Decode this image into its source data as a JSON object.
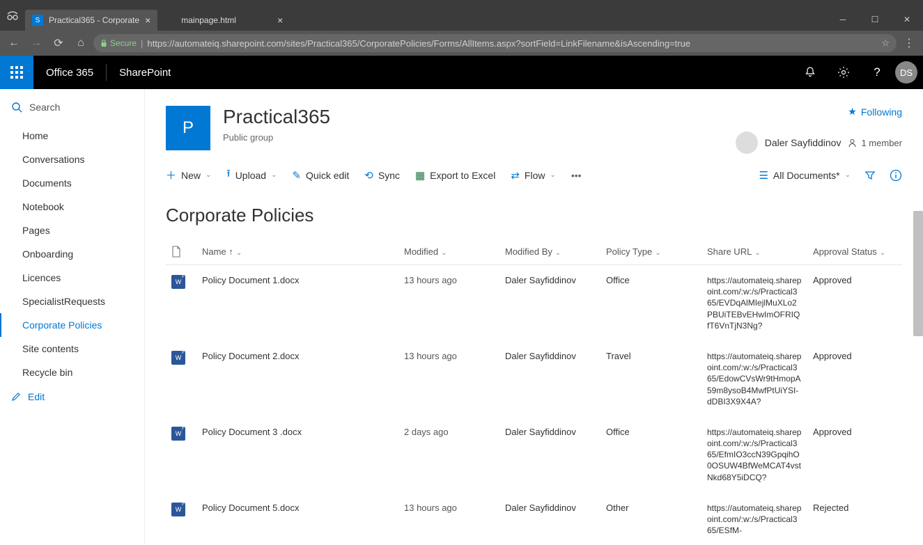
{
  "browser": {
    "tabs": [
      {
        "title": "Practical365 - Corporate",
        "favicon": "S",
        "active": true
      },
      {
        "title": "mainpage.html",
        "favicon": "",
        "active": false
      }
    ],
    "secure_label": "Secure",
    "url": "https://automateiq.sharepoint.com/sites/Practical365/CorporatePolicies/Forms/AllItems.aspx?sortField=LinkFilename&isAscending=true"
  },
  "suite": {
    "o365": "Office 365",
    "app": "SharePoint",
    "avatar": "DS"
  },
  "search": {
    "placeholder": "Search"
  },
  "nav": {
    "items": [
      "Home",
      "Conversations",
      "Documents",
      "Notebook",
      "Pages",
      "Onboarding",
      "Licences",
      "SpecialistRequests",
      "Corporate Policies",
      "Site contents",
      "Recycle bin"
    ],
    "selected_index": 8,
    "edit": "Edit"
  },
  "site": {
    "logo_letter": "P",
    "title": "Practical365",
    "subtitle": "Public group",
    "following": "Following",
    "owner": "Daler Sayfiddinov",
    "members": "1 member"
  },
  "commands": {
    "new": "New",
    "upload": "Upload",
    "quick_edit": "Quick edit",
    "sync": "Sync",
    "export": "Export to Excel",
    "flow": "Flow",
    "view": "All Documents*"
  },
  "list": {
    "title": "Corporate Policies",
    "columns": {
      "name": "Name",
      "modified": "Modified",
      "modified_by": "Modified By",
      "policy_type": "Policy Type",
      "share_url": "Share URL",
      "approval": "Approval Status"
    },
    "rows": [
      {
        "name": "Policy Document 1.docx",
        "modified": "13 hours ago",
        "by": "Daler Sayfiddinov",
        "type": "Office",
        "url": "https://automateiq.sharepoint.com/:w:/s/Practical365/EVDqAlMIejlMuXLo2PBUiTEBvEHwImOFRIQfT6VnTjN3Ng?",
        "approval": "Approved"
      },
      {
        "name": "Policy Document 2.docx",
        "modified": "13 hours ago",
        "by": "Daler Sayfiddinov",
        "type": "Travel",
        "url": "https://automateiq.sharepoint.com/:w:/s/Practical365/EdowCVsWr9tHmopA59m8ysoB4MwfPtUiYSI-dDBI3X9X4A?",
        "approval": "Approved"
      },
      {
        "name": "Policy Document 3 .docx",
        "modified": "2 days ago",
        "by": "Daler Sayfiddinov",
        "type": "Office",
        "url": "https://automateiq.sharepoint.com/:w:/s/Practical365/EfmIO3ccN39GpqihO0OSUW4BfWeMCAT4vstNkd68Y5iDCQ?",
        "approval": "Approved"
      },
      {
        "name": "Policy Document 5.docx",
        "modified": "13 hours ago",
        "by": "Daler Sayfiddinov",
        "type": "Other",
        "url": "https://automateiq.sharepoint.com/:w:/s/Practical365/ESfM-",
        "approval": "Rejected"
      }
    ]
  }
}
